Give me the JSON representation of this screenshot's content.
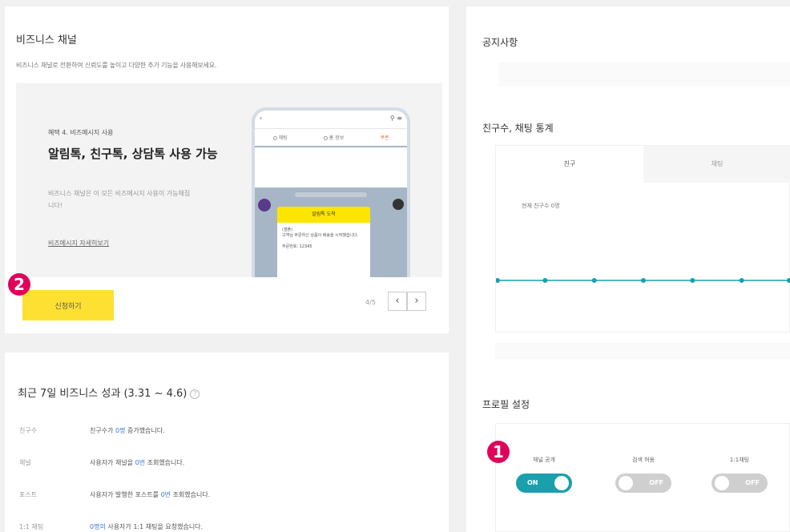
{
  "business_channel": {
    "title": "비즈니스 채널",
    "description": "비즈니스 채널로 전환하여 신뢰도를 높이고 다양한 추가 기능을 사용해보세요.",
    "banner": {
      "benefit_small": "혜택 4. 비즈메시지 사용",
      "headline": "알림톡, 친구톡, 상담톡 사용 가능",
      "subtext": "비즈니스 채널은 이 모든 비즈메시지 사용이 가능해집니다!",
      "more_link": "비즈메시지 자세히보기",
      "phone": {
        "tab_1": "채팅",
        "tab_2": "홈 정보",
        "tab_3": "쿠폰",
        "bubble_title": "알림톡 도착",
        "bubble_text": "(샘플)\n고객님 주문하신 상품이 배송을 시작했습니다.\n\n주문번호: 12345"
      }
    },
    "apply_button": "신청하기",
    "page_indicator": "4/5"
  },
  "recent_performance": {
    "title": "최근 7일 비즈니스 성과 (3.31 ~ 4.6)",
    "help_icon": "?",
    "rows": [
      {
        "label": "친구수",
        "pre": "친구수가 ",
        "highlight": "0명",
        "post": " 증가했습니다."
      },
      {
        "label": "채널",
        "pre": "사용자가 채널을 ",
        "highlight": "0번",
        "post": " 조회했습니다."
      },
      {
        "label": "포스트",
        "pre": "사용자가 발행한 포스트를 ",
        "highlight": "0번",
        "post": " 조회했습니다."
      },
      {
        "label": "1:1 채팅",
        "pre": "",
        "highlight": "0명의",
        "post": " 사용자가 1:1 채팅을 요청했습니다."
      }
    ]
  },
  "notice": {
    "title": "공지사항"
  },
  "stats": {
    "title": "친구수, 채팅 통계",
    "tab_friends": "친구",
    "tab_chat": "채팅",
    "friends_count": "현재 친구수 0명"
  },
  "chart_data": {
    "type": "line",
    "x": [
      1,
      2,
      3,
      4,
      5,
      6,
      7
    ],
    "series": [
      {
        "values": [
          0,
          0,
          0,
          0,
          0,
          0,
          0
        ]
      }
    ],
    "color": "#1a9fad"
  },
  "profile": {
    "title": "프로필 설정",
    "toggles": [
      {
        "label": "채널 공개",
        "state": "ON"
      },
      {
        "label": "검색 허용",
        "state": "OFF"
      },
      {
        "label": "1:1채팅",
        "state": "OFF"
      }
    ]
  },
  "markers": {
    "badge_1": "1",
    "badge_2": "2"
  },
  "colors": {
    "accent_yellow": "#fee033",
    "toggle_on": "#1a9fad",
    "marker": "#e1005a"
  }
}
